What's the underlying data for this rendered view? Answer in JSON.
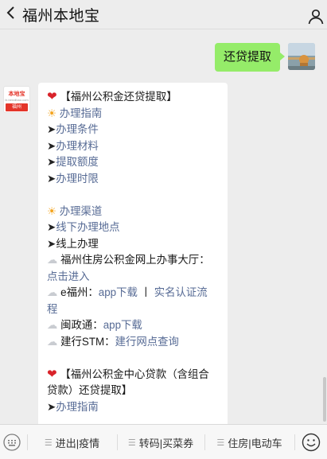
{
  "header": {
    "title": "福州本地宝",
    "back_icon": "chevron-left-icon",
    "profile_icon": "person-icon"
  },
  "my_message": {
    "text": "还贷提取"
  },
  "bot_avatar": {
    "brand": "本地宝",
    "url": "fz.bendibao.com",
    "city": "福州"
  },
  "bot_message": {
    "section1_title": "【福州公积金还贷提取】",
    "guide_heading": "办理指南",
    "guide_items": [
      "办理条件",
      "办理材料",
      "提取额度",
      "办理时限"
    ],
    "channel_heading": "办理渠道",
    "offline": "线下办理地点",
    "online": "线上办理",
    "hall_prefix": "福州住房公积金网上办事大厅：",
    "hall_link": "点击进入",
    "efz_prefix": "e福州：",
    "efz_download": "app下载",
    "efz_sep": "丨",
    "efz_verify_part1": "实名认证流",
    "efz_verify_part2": "程",
    "mzt_prefix": "闽政通：",
    "mzt_download": "app下载",
    "ccb_prefix": "建行STM：",
    "ccb_link": "建行网点查询",
    "section2_title_part1": "【福州公积金中心贷款（含组合",
    "section2_title_part2": "贷款）还贷提取】",
    "section2_first_item": "办理指南"
  },
  "bottom_menu": [
    {
      "label": "进出|疫情"
    },
    {
      "label": "转码|买菜券"
    },
    {
      "label": "住房|电动车"
    }
  ],
  "colors": {
    "link": "#576b95",
    "my_bubble": "#95ec69",
    "heart": "#d9232a"
  }
}
